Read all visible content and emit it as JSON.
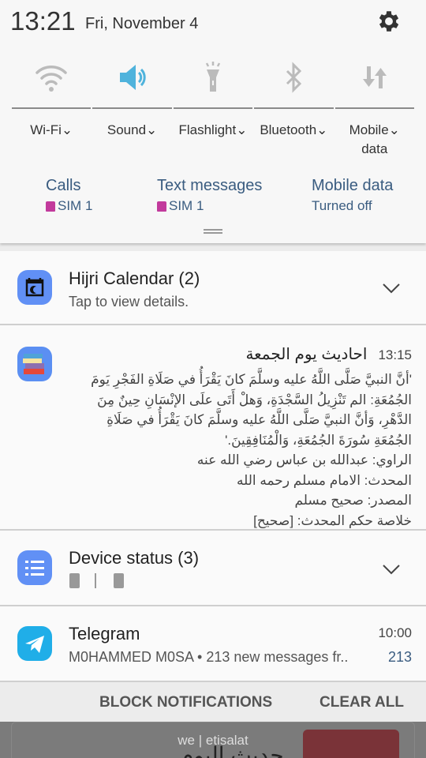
{
  "status": {
    "time": "13:21",
    "date": "Fri, November 4"
  },
  "quick_tiles": [
    {
      "label": "Wi-Fi",
      "icon": "wifi-icon",
      "active": false
    },
    {
      "label": "Sound",
      "icon": "speaker-icon",
      "active": true
    },
    {
      "label": "Flashlight",
      "icon": "flashlight-icon",
      "active": false
    },
    {
      "label": "Bluetooth",
      "icon": "bluetooth-icon",
      "active": false
    },
    {
      "label": "Mobile data",
      "label_line1": "Mobile",
      "label_line2": "data",
      "icon": "data-arrows-icon",
      "active": false
    }
  ],
  "sim_info": {
    "calls": {
      "title": "Calls",
      "value": "SIM 1"
    },
    "texts": {
      "title": "Text messages",
      "value": "SIM 1"
    },
    "data": {
      "title": "Mobile data",
      "value": "Turned off"
    }
  },
  "notifications": {
    "hijri": {
      "title": "Hijri Calendar (2)",
      "subtitle": "Tap to view details."
    },
    "hadith": {
      "title": "احاديث يوم الجمعة",
      "time": "13:15",
      "body": "'أنَّ النبيَّ صَلَّى اللَّهُ عليه وسلَّمَ كانَ يَقْرَأُ في صَلَاةِ الفَجْرِ يَومَ الجُمُعَةِ: الم تَنْزِيلُ السَّجْدَةِ، وَهلْ أَتَى علَى الإنْسَانِ حِينٌ مِنَ الدَّهْرِ، وَأنَّ النبيَّ صَلَّى اللَّهُ عليه وسلَّمَ كانَ يَقْرَأُ في صَلَاةِ الجُمُعَةِ سُورَةَ الجُمُعَةِ، وَالْمُنَافِقِينَ.'",
      "narrator": "الراوي: عبدالله بن عباس رضي الله عنه",
      "scholar": "المحدث: الامام مسلم رحمه الله",
      "source": "المصدر: صحيح مسلم",
      "verdict": "خلاصة حكم المحدث: [صحيح]"
    },
    "device": {
      "title": "Device status (3)"
    },
    "telegram": {
      "title": "Telegram",
      "time": "10:00",
      "text": "M0HAMMED M0SA • 213 new messages fr..",
      "count": "213"
    }
  },
  "footer": {
    "block": "BLOCK NOTIFICATIONS",
    "clear": "CLEAR ALL"
  },
  "background": {
    "carrier": "we | etisalat",
    "widget_text": "حديث اليوم"
  },
  "colors": {
    "accent": "#4fb3dc",
    "sim_link": "#3a5c80",
    "sim_icon": "#c23a9c",
    "telegram": "#20aee8"
  }
}
